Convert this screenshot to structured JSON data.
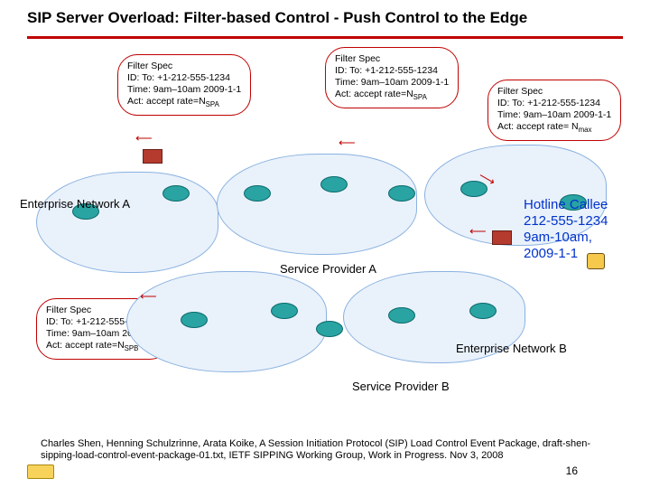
{
  "title": "SIP Server Overload: Filter-based Control - Push Control to the Edge",
  "callouts": {
    "topLeft": {
      "l1": "Filter Spec",
      "l2": "ID: To: +1-212-555-1234",
      "l3": "Time: 9am–10am 2009-1-1",
      "l4pre": "Act: accept rate=N",
      "l4sub": "SPA"
    },
    "topMid": {
      "l1": "Filter Spec",
      "l2": "ID: To: +1-212-555-1234",
      "l3": "Time: 9am–10am 2009-1-1",
      "l4pre": "Act: accept rate=N",
      "l4sub": "SPA"
    },
    "topRight": {
      "l1": "Filter Spec",
      "l2": "ID: To: +1-212-555-1234",
      "l3": "Time: 9am–10am 2009-1-1",
      "l4pre": "Act: accept rate= N",
      "l4sub": "max"
    },
    "bottom": {
      "l1": "Filter Spec",
      "l2": "ID: To: +1-212-555-1234",
      "l3": "Time: 9am–10am 2009-1-1",
      "l4pre": "Act: accept rate=N",
      "l4sub": "SPB"
    }
  },
  "labels": {
    "entA": "Enterprise Network A",
    "entB": "Enterprise Network B",
    "spA": "Service Provider A",
    "spB": "Service Provider B",
    "hotline1": "Hotline Callee",
    "hotline2": "212-555-1234",
    "hotline3": "9am-10am,",
    "hotline4": "2009-1-1"
  },
  "footer": "Charles Shen, Henning Schulzrinne, Arata Koike, A Session Initiation Protocol (SIP) Load Control Event Package, draft-shen-sipping-load-control-event-package-01.txt, IETF SIPPING Working Group, Work in Progress. Nov 3, 2008",
  "pagenum": "16"
}
